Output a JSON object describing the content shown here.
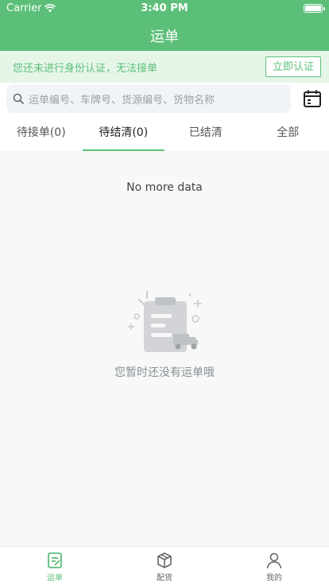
{
  "status_bar": {
    "carrier": "Carrier",
    "time": "3:40 PM"
  },
  "header": {
    "title": "运单"
  },
  "notice": {
    "text": "您还未进行身份认证，无法接单",
    "button": "立即认证"
  },
  "search": {
    "placeholder": "运单编号、车牌号、货源编号、货物名称"
  },
  "tabs": [
    {
      "label": "待接单(0)"
    },
    {
      "label": "待结清(0)"
    },
    {
      "label": "已结清"
    },
    {
      "label": "全部"
    }
  ],
  "content": {
    "no_more": "No more data",
    "empty_text": "您暂时还没有运单哦"
  },
  "tabbar": [
    {
      "label": "运单",
      "icon": "document-icon"
    },
    {
      "label": "配货",
      "icon": "box-icon"
    },
    {
      "label": "我的",
      "icon": "person-icon"
    }
  ],
  "colors": {
    "accent": "#5cbf79",
    "notice_bg": "#e5f6e9"
  }
}
